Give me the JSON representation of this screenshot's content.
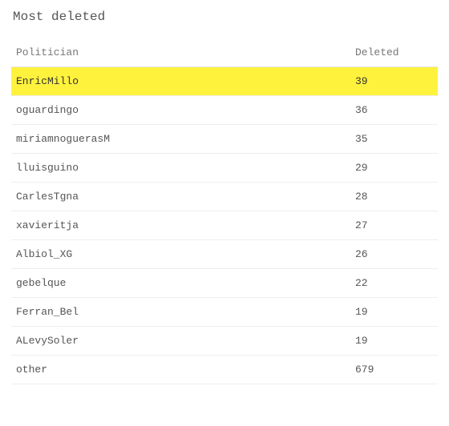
{
  "title": "Most deleted",
  "columns": {
    "politician": "Politician",
    "deleted": "Deleted"
  },
  "rows": [
    {
      "politician": "EnricMillo",
      "deleted": 39,
      "highlight": true
    },
    {
      "politician": "oguardingo",
      "deleted": 36,
      "highlight": false
    },
    {
      "politician": "miriamnoguerasM",
      "deleted": 35,
      "highlight": false
    },
    {
      "politician": "lluisguino",
      "deleted": 29,
      "highlight": false
    },
    {
      "politician": "CarlesTgna",
      "deleted": 28,
      "highlight": false
    },
    {
      "politician": "xavieritja",
      "deleted": 27,
      "highlight": false
    },
    {
      "politician": "Albiol_XG",
      "deleted": 26,
      "highlight": false
    },
    {
      "politician": "gebelque",
      "deleted": 22,
      "highlight": false
    },
    {
      "politician": "Ferran_Bel",
      "deleted": 19,
      "highlight": false
    },
    {
      "politician": "ALevySoler",
      "deleted": 19,
      "highlight": false
    },
    {
      "politician": "other",
      "deleted": 679,
      "highlight": false
    }
  ],
  "chart_data": {
    "type": "table",
    "title": "Most deleted",
    "columns": [
      "Politician",
      "Deleted"
    ],
    "rows": [
      [
        "EnricMillo",
        39
      ],
      [
        "oguardingo",
        36
      ],
      [
        "miriamnoguerasM",
        35
      ],
      [
        "lluisguino",
        29
      ],
      [
        "CarlesTgna",
        28
      ],
      [
        "xavieritja",
        27
      ],
      [
        "Albiol_XG",
        26
      ],
      [
        "gebelque",
        22
      ],
      [
        "Ferran_Bel",
        19
      ],
      [
        "ALevySoler",
        19
      ],
      [
        "other",
        679
      ]
    ],
    "highlighted_row_index": 0
  }
}
